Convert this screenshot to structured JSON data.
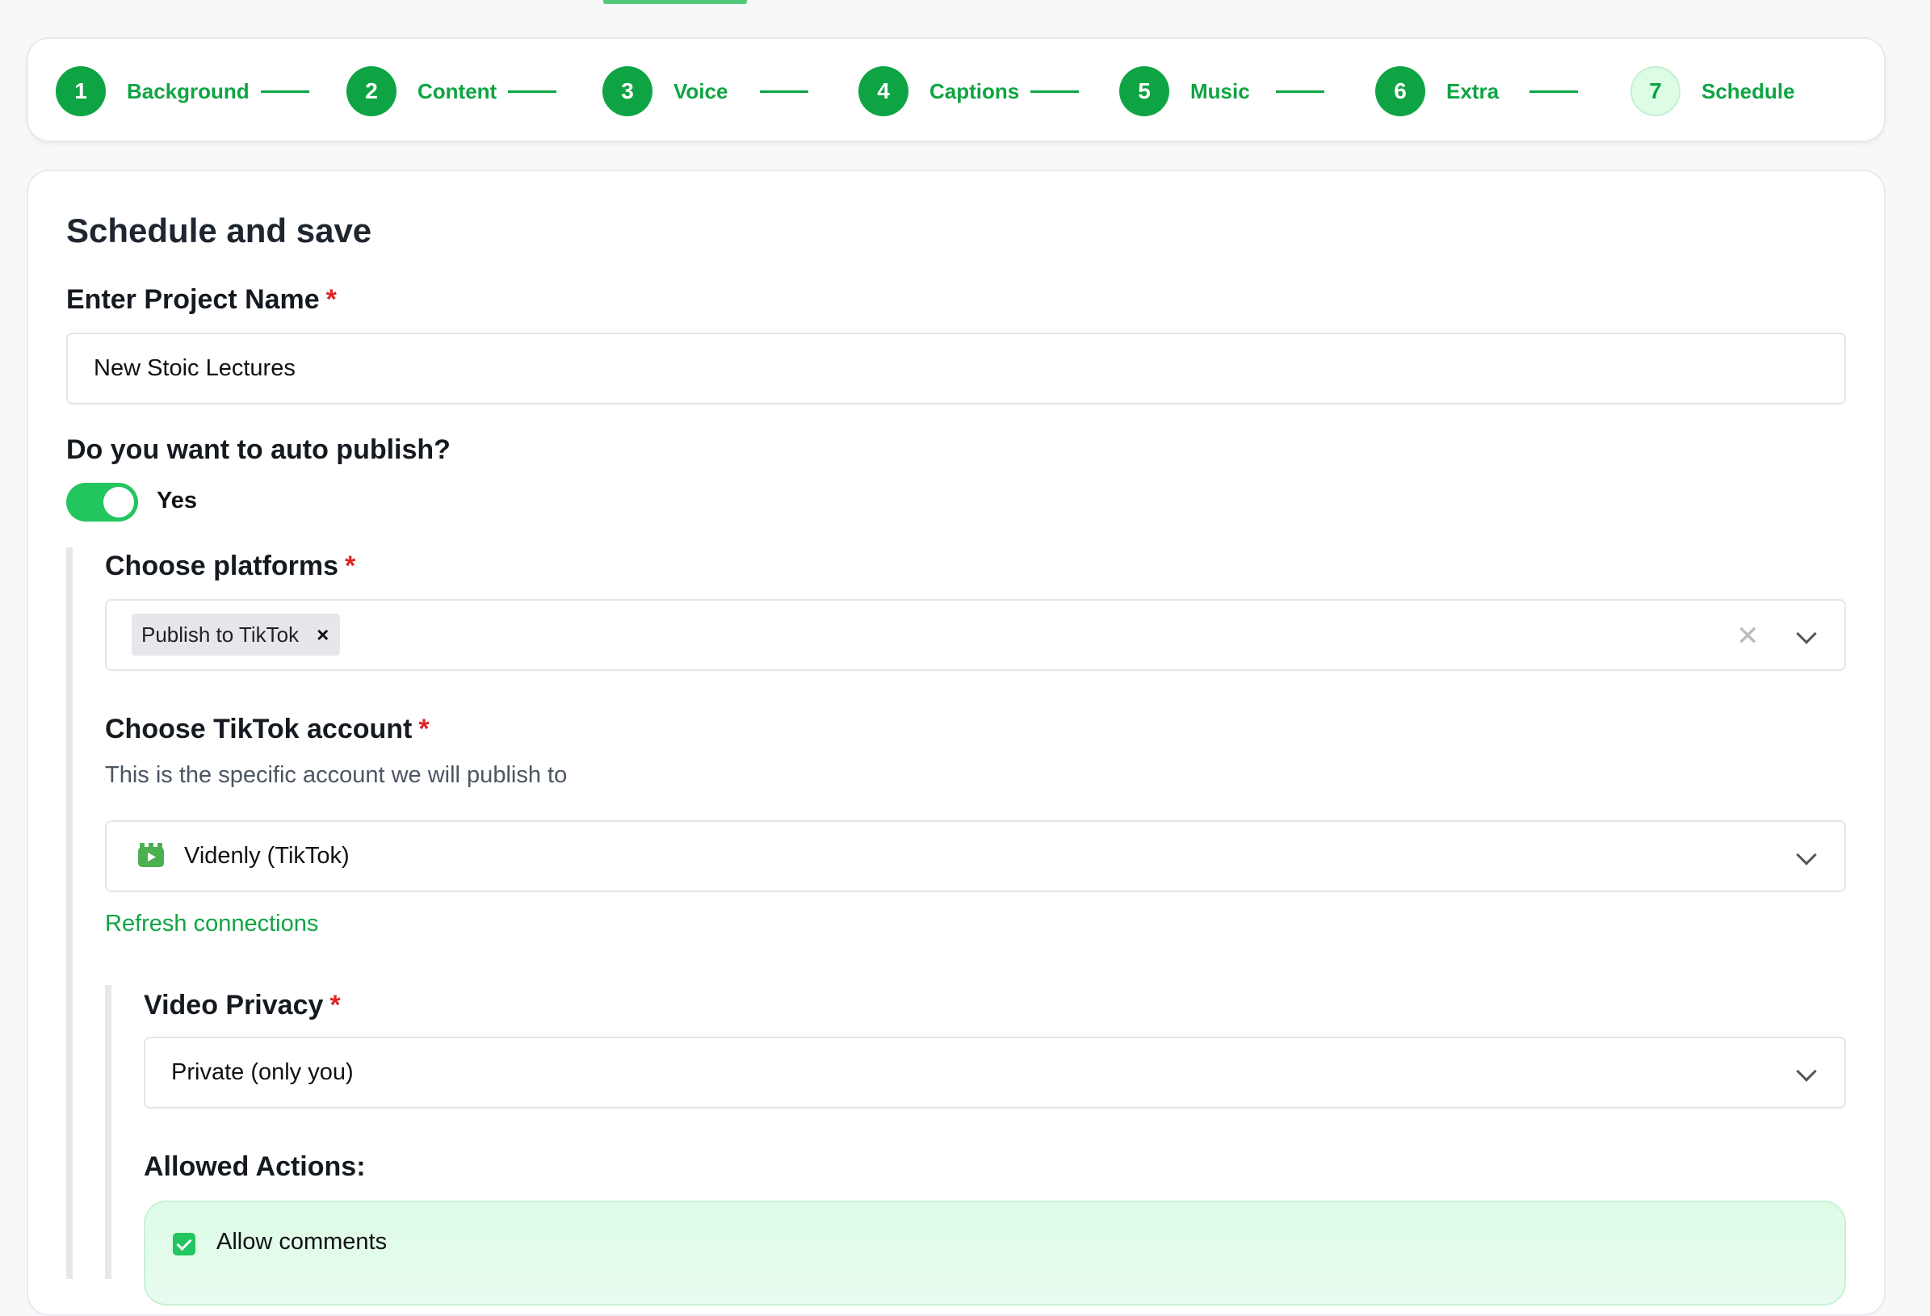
{
  "stepper": {
    "steps": [
      {
        "number": "1",
        "label": "Background",
        "state": "done"
      },
      {
        "number": "2",
        "label": "Content",
        "state": "done"
      },
      {
        "number": "3",
        "label": "Voice",
        "state": "done"
      },
      {
        "number": "4",
        "label": "Captions",
        "state": "done"
      },
      {
        "number": "5",
        "label": "Music",
        "state": "done"
      },
      {
        "number": "6",
        "label": "Extra",
        "state": "done"
      },
      {
        "number": "7",
        "label": "Schedule",
        "state": "current"
      }
    ]
  },
  "form": {
    "title": "Schedule and save",
    "project_name": {
      "label": "Enter Project Name",
      "required": "*",
      "value": "New Stoic Lectures"
    },
    "auto_publish": {
      "label": "Do you want to auto publish?",
      "toggle_on": true,
      "toggle_label": "Yes"
    },
    "platforms": {
      "label": "Choose platforms",
      "required": "*",
      "selected_chip": "Publish to TikTok",
      "chip_remove": "×",
      "clear_icon": "close-icon",
      "dropdown_icon": "chevron-down-icon"
    },
    "tiktok_account": {
      "label": "Choose TikTok account",
      "required": "*",
      "help": "This is the specific account we will publish to",
      "value": "Videnly (TikTok)",
      "icon": "video-clip-icon"
    },
    "refresh_link": "Refresh connections",
    "video_privacy": {
      "label": "Video Privacy",
      "required": "*",
      "value": "Private (only you)"
    },
    "allowed_actions": {
      "label": "Allowed Actions:",
      "items": [
        {
          "label": "Allow comments",
          "checked": true
        }
      ]
    }
  },
  "colors": {
    "accent": "#0fa443",
    "toggle": "#22c55e",
    "required": "#e02424"
  }
}
